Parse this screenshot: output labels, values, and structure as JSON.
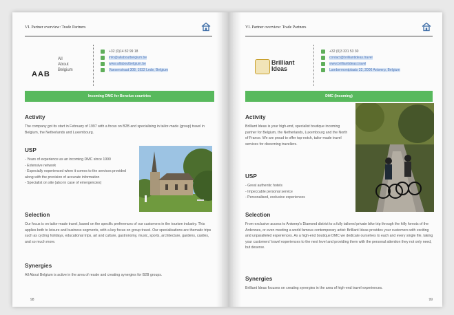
{
  "left": {
    "header_title": "VI. Partner overview: Trade Partners",
    "logo": {
      "big": "AAB",
      "small_lines": [
        "All",
        "About",
        "Belgium"
      ]
    },
    "contact": [
      "+32 (0)14 82 99 18",
      "info@allaboutbelgium.be",
      "www.allaboutbelgium.be",
      "Vaesenstraat 308, 1932 Lede, Belgium"
    ],
    "banner": "Incoming DMC for Benelux countries",
    "activity_h": "Activity",
    "activity_p": "The company got its start in February of 1997 with a focus on B2B and specialising in tailor-made (group) travel in Belgium, the Netherlands and Luxembourg.",
    "usp_h": "USP",
    "usp_items": [
      "Years of experience as an incoming DMC since 1990",
      "Extensive network",
      "Especially experienced when it comes to the services provided along with the provision of accurate information",
      "Specialist on site (also in case of emergencies)"
    ],
    "selection_h": "Selection",
    "selection_p": "Our focus is on tailor-made travel, based on the specific preferences of our customers in the tourism industry. This applies both to leisure and business segments, with a key focus on group travel. Our specialisations are thematic trips such as cycling holidays, educational trips, art and culture, gastronomy, music, sports, architecture, gardens, castles, and so much more.",
    "synergies_h": "Synergies",
    "synergies_p": "All About Belgium is active in the area of resale and creating synergies for B2B groups.",
    "page_num": "98"
  },
  "right": {
    "header_title": "VI. Partner overview: Trade Partners",
    "logo": {
      "lines": [
        "Brilliant",
        "Ideas"
      ]
    },
    "contact": [
      "+32 (0)3 331 53 30",
      "contact@brilliantideas.travel",
      "www.brilliantideas.travel",
      "Lambermontplaats 32, 2000 Antwerp, Belgium"
    ],
    "banner": "DMC (Incoming)",
    "activity_h": "Activity",
    "activity_p": "Brilliant Ideas is your high-end, specialist boutique incoming partner for Belgium, the Netherlands, Luxembourg and the North of France. We are proud to offer top-notch, tailor-made travel services for discerning travellers.",
    "usp_h": "USP",
    "usp_items": [
      "Great authentic hotels",
      "Impeccable personal service",
      "Personalised, exclusive experiences"
    ],
    "selection_h": "Selection",
    "selection_p": "From exclusive access to Antwerp's Diamond district to a fully tailored private bike trip through the hilly forests of the Ardennes, or even meeting a world famous contemporary artist: Brilliant Ideas provides your customers with exciting and unparalleled experiences. As a high-end boutique DMC we dedicate ourselves to each and every single file, taking your customers' travel experiences to the next level and providing them with the personal attention they not only need, but deserve.",
    "synergies_h": "Synergies",
    "synergies_p": "Brilliant Ideas focuses on creating synergies in the area of high-end travel experiences.",
    "page_num": "99"
  },
  "colors": {
    "accent_green": "#58b95d",
    "home_icon": "#3f6ea8"
  }
}
